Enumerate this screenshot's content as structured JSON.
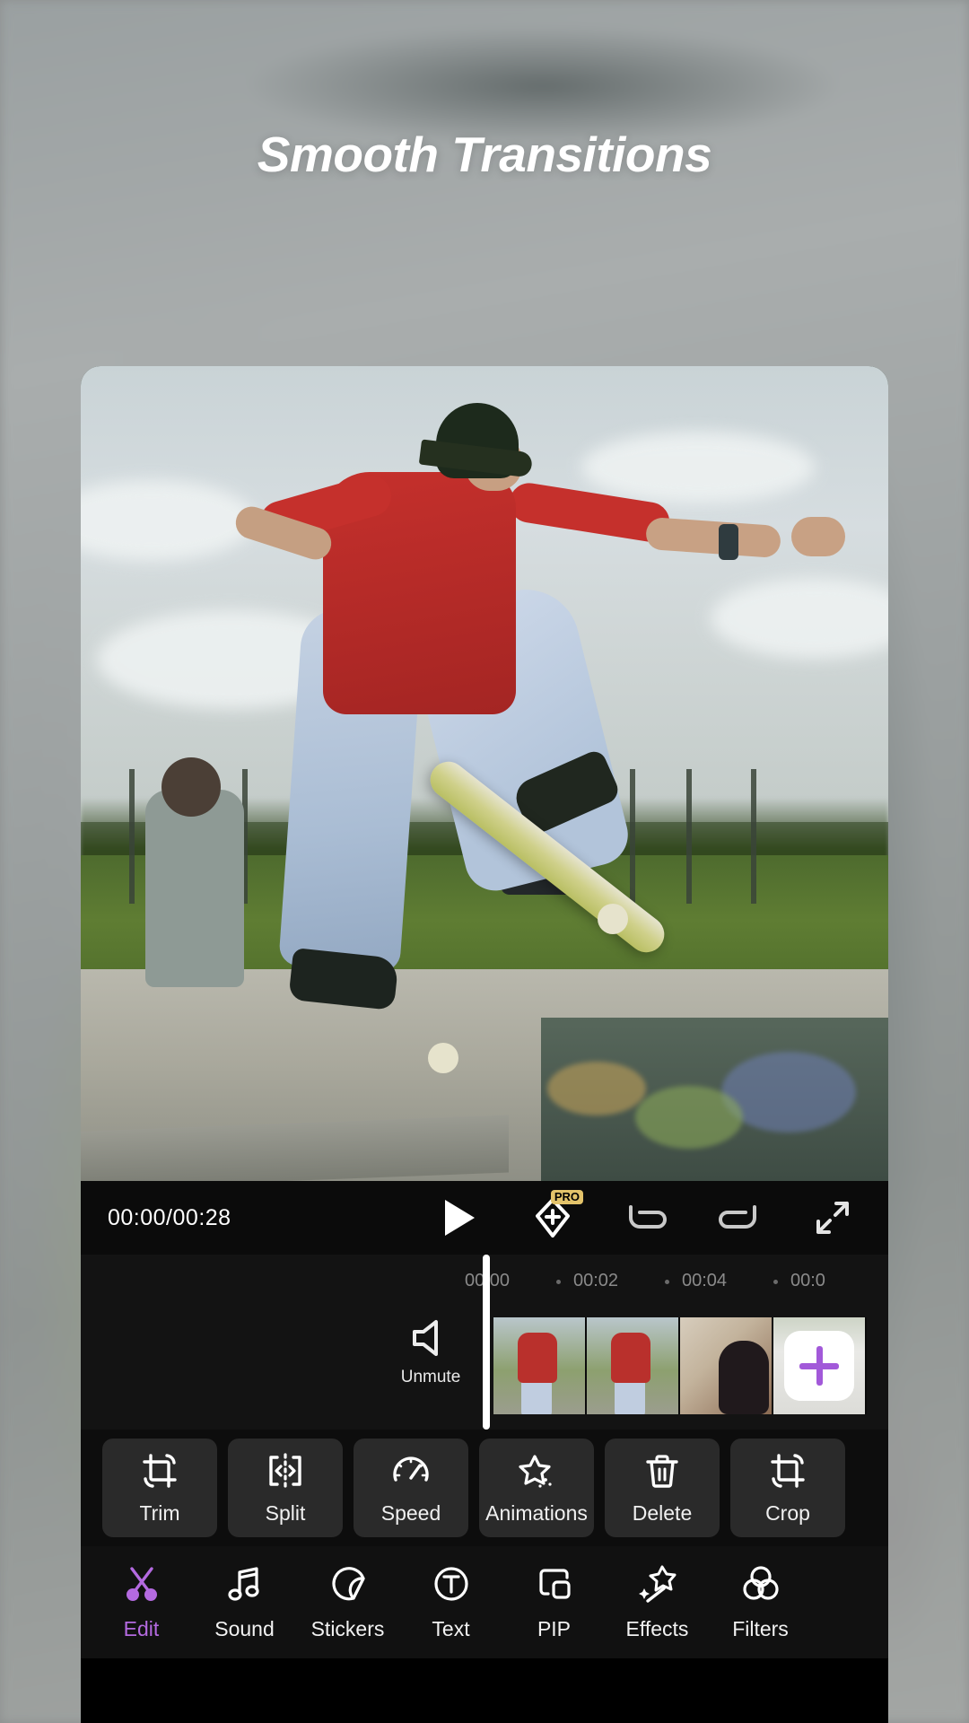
{
  "headline": "Smooth Transitions",
  "player": {
    "timecode": "00:00/00:28",
    "play_label": "play",
    "keyframe_label": "keyframe",
    "pro_badge": "PRO",
    "undo_label": "undo",
    "redo_label": "redo",
    "fullscreen_label": "fullscreen"
  },
  "timeline": {
    "ticks": [
      "00:00",
      "00:02",
      "00:04",
      "00:0"
    ],
    "unmute_label": "Unmute",
    "add_clip_label": "+"
  },
  "actions": [
    {
      "label": "Trim",
      "icon": "trim-icon"
    },
    {
      "label": "Split",
      "icon": "split-icon"
    },
    {
      "label": "Speed",
      "icon": "speed-icon"
    },
    {
      "label": "Animations",
      "icon": "animations-icon"
    },
    {
      "label": "Delete",
      "icon": "delete-icon"
    },
    {
      "label": "Crop",
      "icon": "crop-icon"
    }
  ],
  "nav": [
    {
      "label": "Edit",
      "icon": "scissors-icon",
      "active": true
    },
    {
      "label": "Sound",
      "icon": "music-note-icon",
      "active": false
    },
    {
      "label": "Stickers",
      "icon": "sticker-icon",
      "active": false
    },
    {
      "label": "Text",
      "icon": "text-icon",
      "active": false
    },
    {
      "label": "PIP",
      "icon": "pip-icon",
      "active": false
    },
    {
      "label": "Effects",
      "icon": "effects-icon",
      "active": false
    },
    {
      "label": "Filters",
      "icon": "filters-icon",
      "active": false
    }
  ],
  "colors": {
    "accent": "#a259d9",
    "accent_text": "#b46ae0",
    "pro_badge": "#e3c36a",
    "app_background": "#0d0d0d",
    "headline_color": "#ffffff"
  }
}
